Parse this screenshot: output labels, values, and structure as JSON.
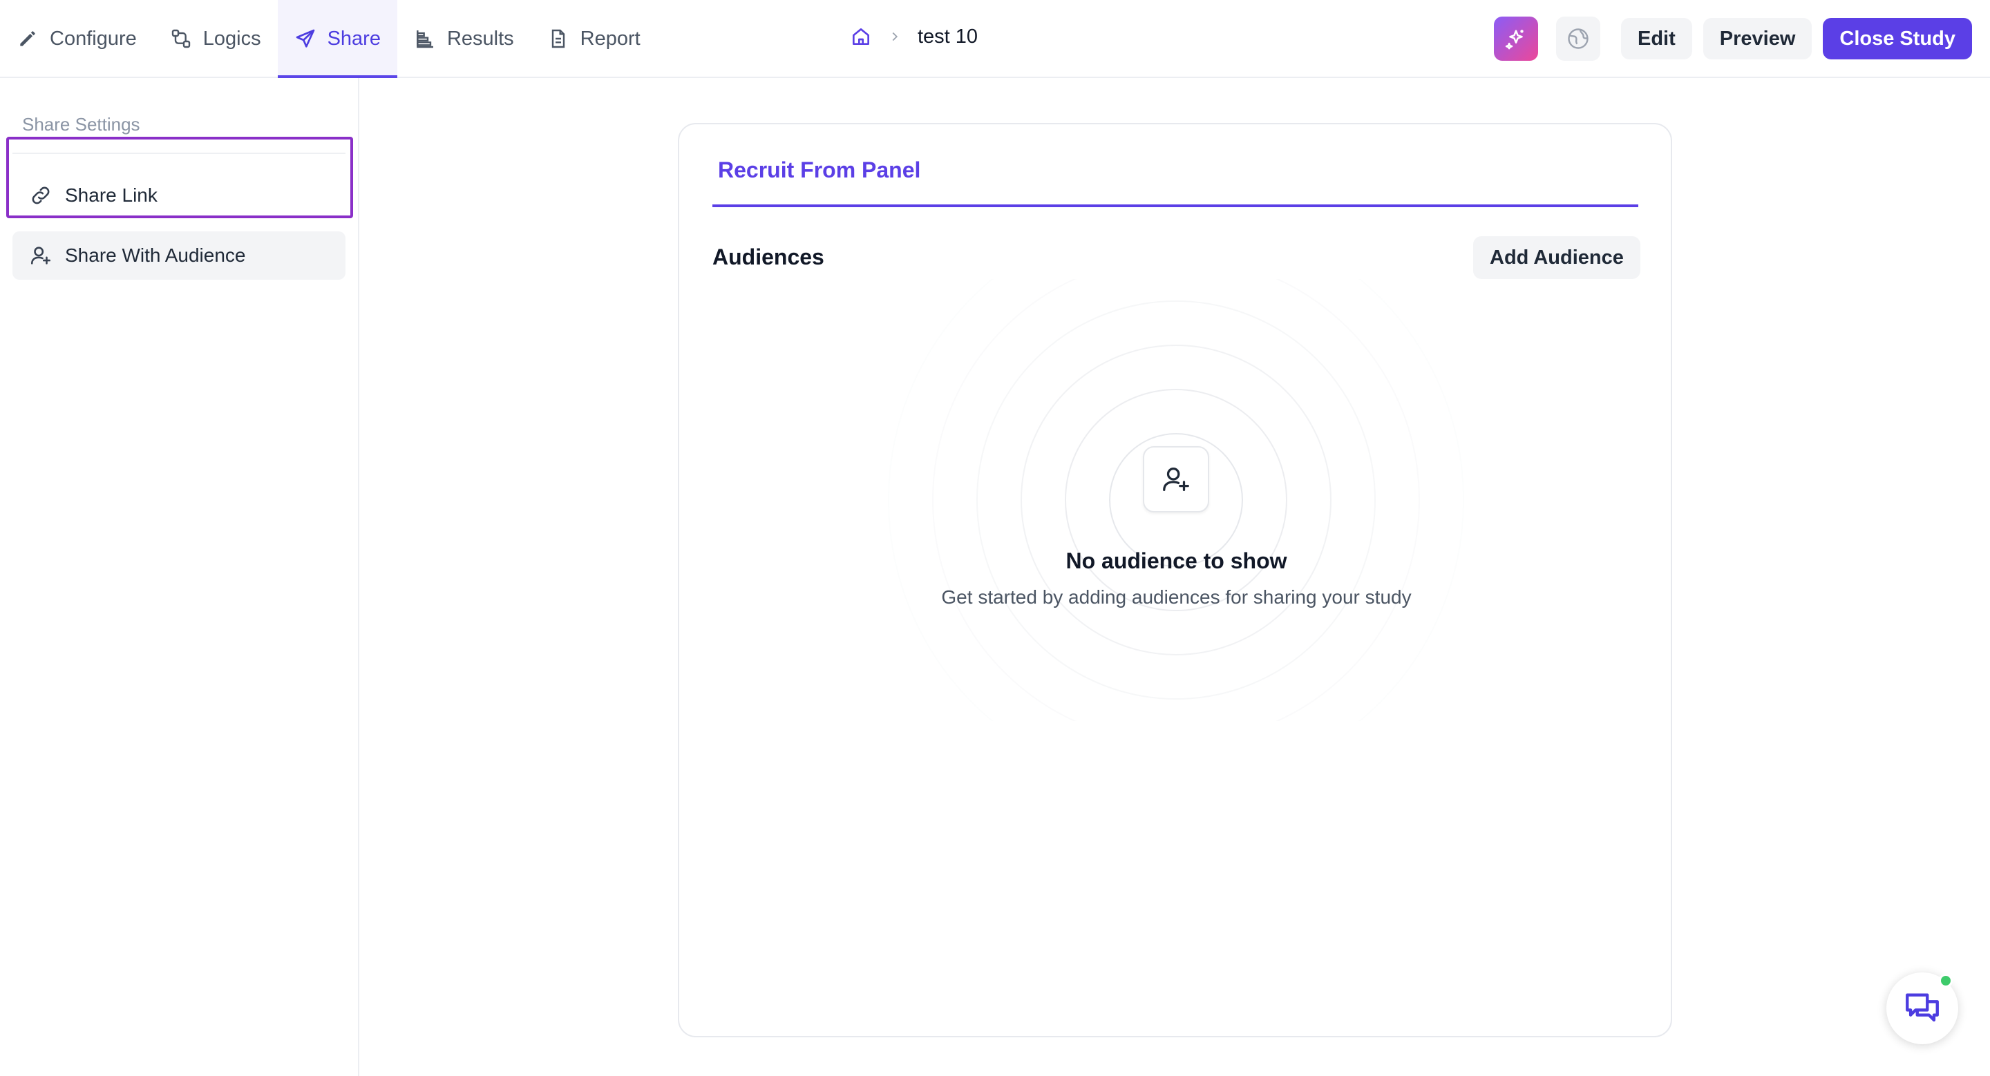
{
  "nav": {
    "tabs": [
      {
        "label": "Configure",
        "icon": "pencil-icon"
      },
      {
        "label": "Logics",
        "icon": "logic-nodes-icon"
      },
      {
        "label": "Share",
        "icon": "send-icon",
        "active": true
      },
      {
        "label": "Results",
        "icon": "bar-chart-icon"
      },
      {
        "label": "Report",
        "icon": "document-icon"
      }
    ]
  },
  "breadcrumb": {
    "home_icon": "home-icon",
    "separator_icon": "chevron-right-icon",
    "study_name": "test 10"
  },
  "actions": {
    "ai_icon": "sparkles-icon",
    "theme_icon": "globe-palette-icon",
    "edit_label": "Edit",
    "preview_label": "Preview",
    "close_label": "Close Study"
  },
  "sidebar": {
    "heading": "Share Settings",
    "items": [
      {
        "label": "Share Link",
        "icon": "link-icon"
      },
      {
        "label": "Share With Audience",
        "icon": "user-plus-icon",
        "selected": true
      }
    ]
  },
  "main": {
    "tab_label": "Recruit From Panel",
    "section_title": "Audiences",
    "add_button": "Add Audience",
    "empty_state": {
      "icon": "user-plus-icon",
      "title": "No audience to show",
      "subtitle": "Get started by adding audiences for sharing your study"
    }
  },
  "chat": {
    "icon": "chat-bubbles-icon",
    "online": true
  },
  "colors": {
    "accent": "#5b3fe6",
    "active_tab_bg": "#f4f3fd",
    "selection_outline": "#8a2fc8",
    "online": "#3ecb6b"
  }
}
